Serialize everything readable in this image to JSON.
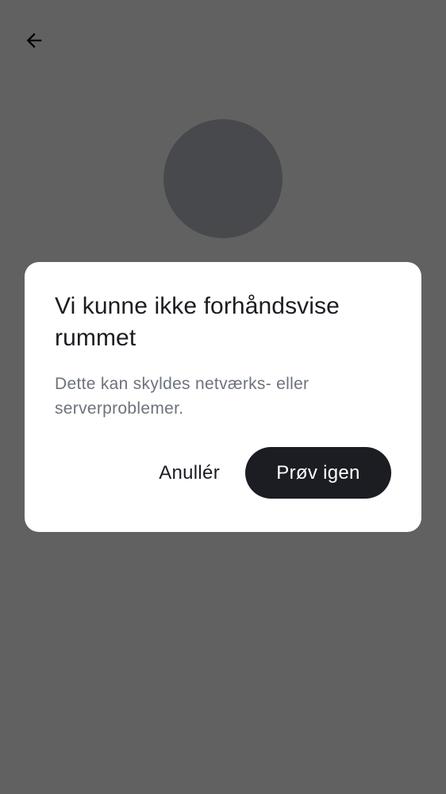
{
  "background_page": {
    "back_icon": "arrow-left-icon",
    "avatar": "avatar-placeholder"
  },
  "dialog": {
    "title": "Vi kunne ikke forhåndsvise rummet",
    "body": "Dette kan skyldes netværks- eller serverproblemer.",
    "cancel_label": "Anullér",
    "retry_label": "Prøv igen"
  },
  "colors": {
    "scrim": "#000000",
    "dialog_background": "#ffffff",
    "primary_button": "#1b1d22",
    "title_text": "#1b1d22",
    "body_text": "#6d737c",
    "avatar_placeholder": "#bcc1c7"
  }
}
